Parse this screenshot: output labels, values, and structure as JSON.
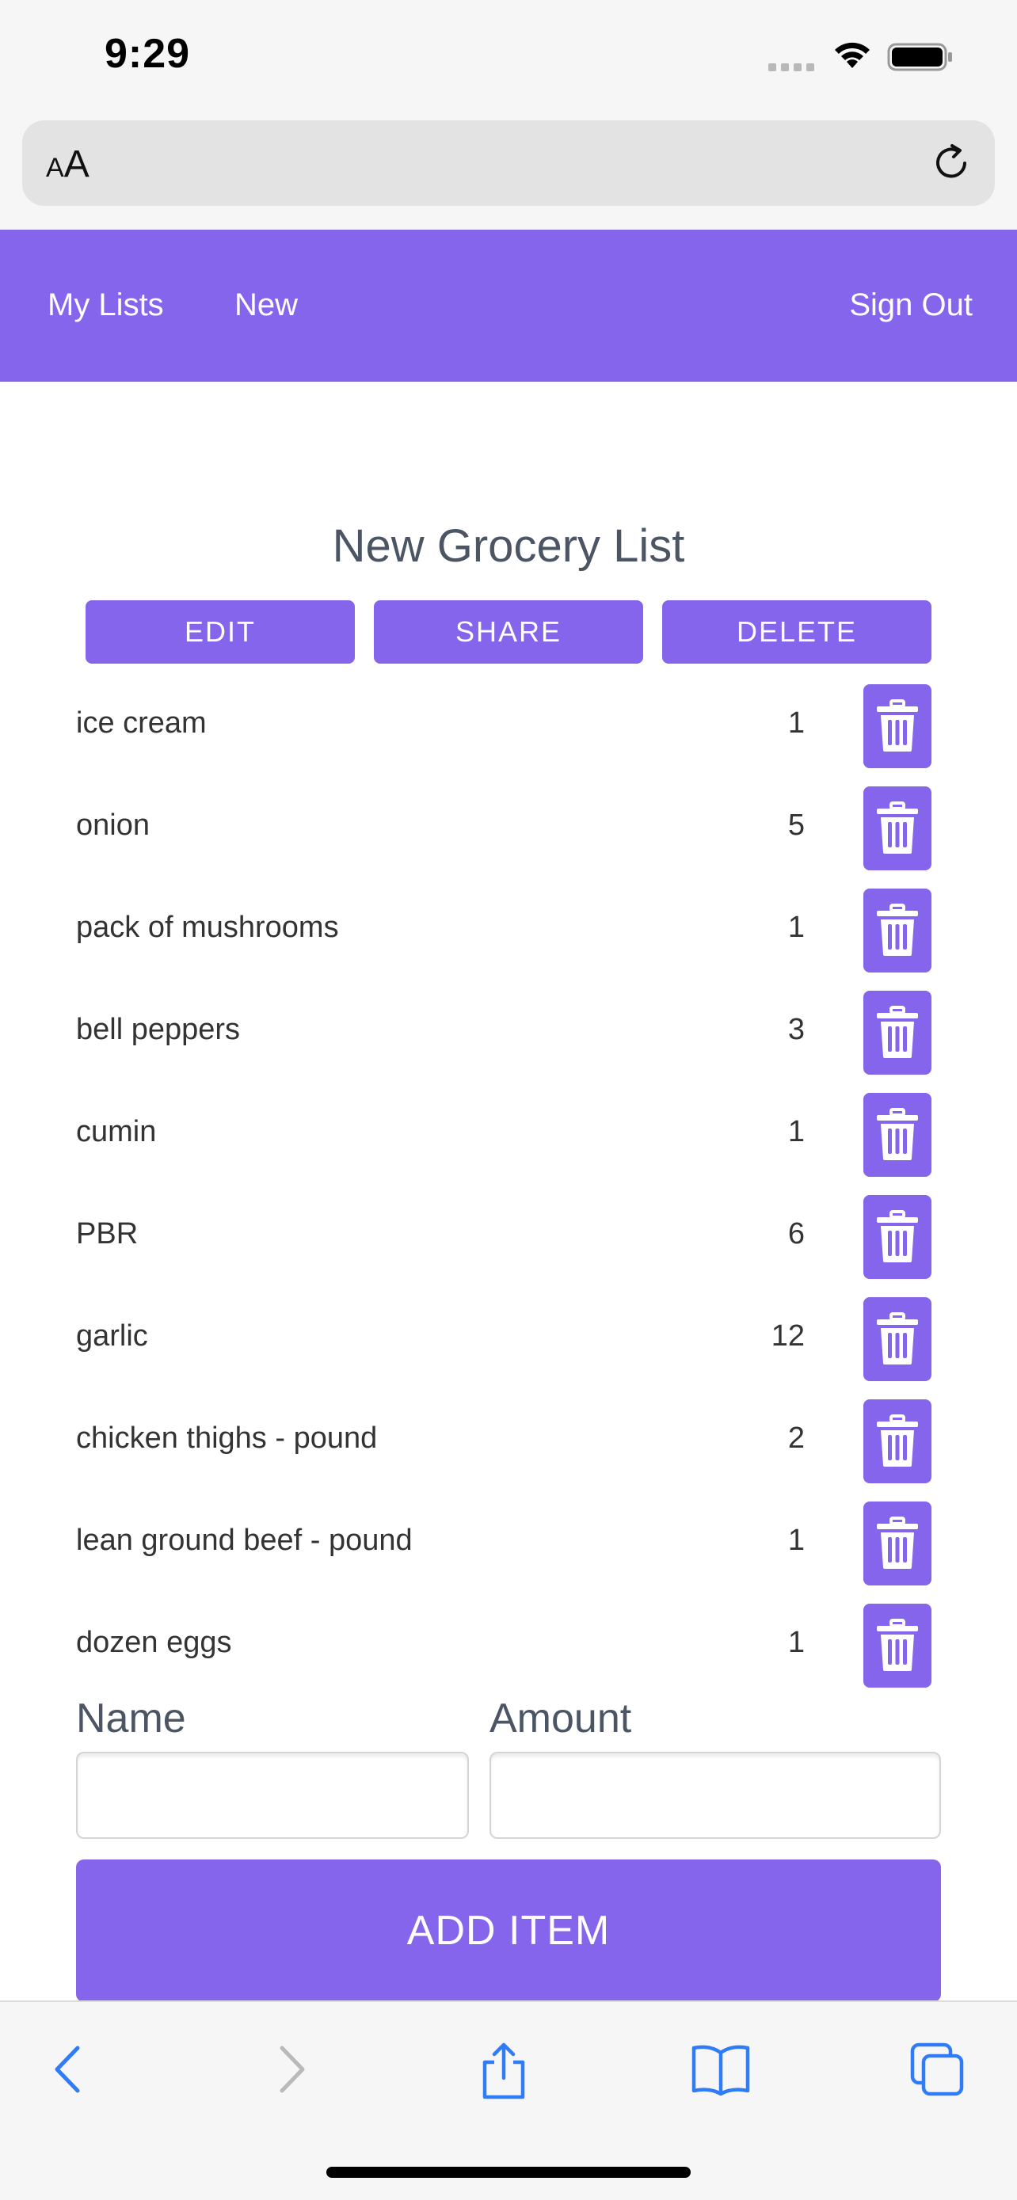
{
  "status": {
    "time": "9:29"
  },
  "browser": {
    "text_size_label_small": "A",
    "text_size_label_large": "A"
  },
  "nav": {
    "my_lists": "My Lists",
    "new": "New",
    "sign_out": "Sign Out"
  },
  "list": {
    "title": "New Grocery List",
    "edit_label": "EDIT",
    "share_label": "SHARE",
    "delete_label": "DELETE",
    "items": [
      {
        "name": "ice cream",
        "amount": "1"
      },
      {
        "name": "onion",
        "amount": "5"
      },
      {
        "name": "pack of mushrooms",
        "amount": "1"
      },
      {
        "name": "bell peppers",
        "amount": "3"
      },
      {
        "name": "cumin",
        "amount": "1"
      },
      {
        "name": "PBR",
        "amount": "6"
      },
      {
        "name": "garlic",
        "amount": "12"
      },
      {
        "name": "chicken thighs - pound",
        "amount": "2"
      },
      {
        "name": "lean ground beef - pound",
        "amount": "1"
      },
      {
        "name": "dozen eggs",
        "amount": "1"
      }
    ]
  },
  "form": {
    "name_label": "Name",
    "amount_label": "Amount",
    "name_value": "",
    "amount_value": "",
    "add_label": "ADD ITEM"
  },
  "colors": {
    "accent": "#8465ec",
    "text": "#4b5563"
  }
}
